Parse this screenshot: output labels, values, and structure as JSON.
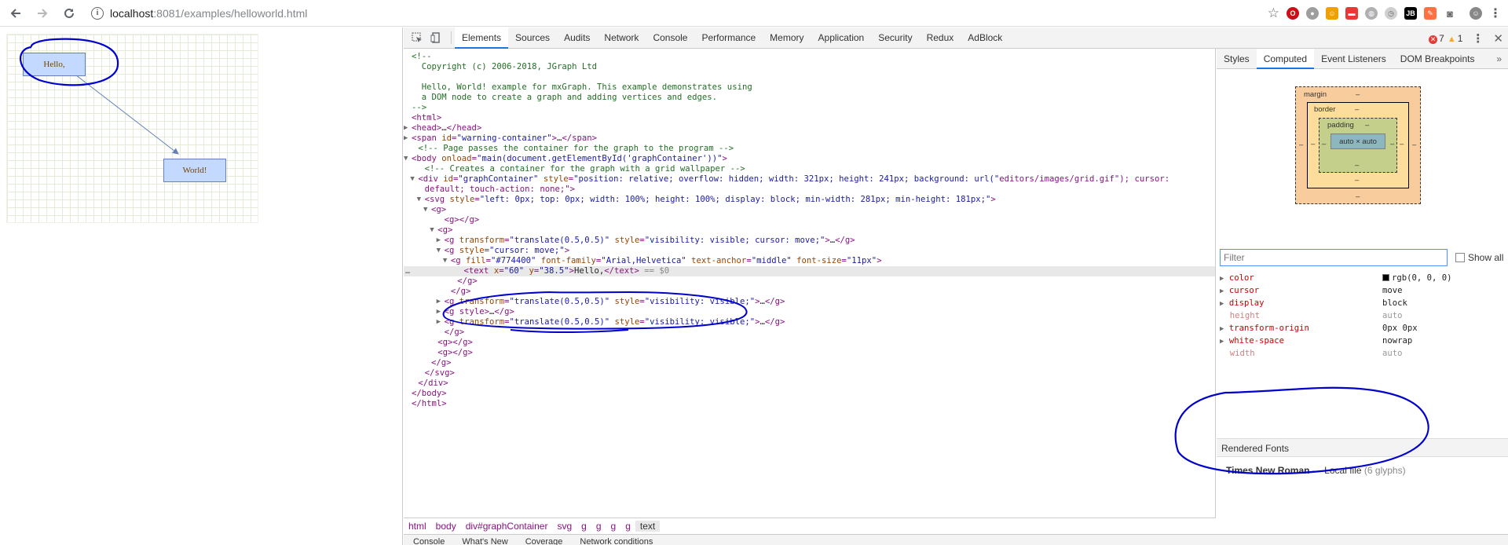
{
  "browser": {
    "url_host": "localhost",
    "url_path": ":8081/examples/helloworld.html"
  },
  "graph": {
    "vertex1_label": "Hello,",
    "vertex2_label": "World!"
  },
  "devtools": {
    "tabs": [
      "Elements",
      "Sources",
      "Audits",
      "Network",
      "Console",
      "Performance",
      "Memory",
      "Application",
      "Security",
      "Redux",
      "AdBlock"
    ],
    "errors": "7",
    "warnings": "1",
    "code_lines": [
      "<!--",
      "  Copyright (c) 2006-2018, JGraph Ltd",
      "",
      "  Hello, World! example for mxGraph. This example demonstrates using",
      "  a DOM node to create a graph and adding vertices and edges.",
      "-->",
      "<html>",
      "<head>…</head>",
      "<span id=\"warning-container\">…</span>",
      "<!-- Page passes the container for the graph to the program -->",
      "<body onload=\"main(document.getElementById('graphContainer'))\">",
      "<!-- Creates a container for the graph with a grid wallpaper -->",
      "<div id=\"graphContainer\" style=\"position: relative; overflow: hidden; width: 321px; height: 241px; background: url(\"editors/images/grid.gif\"); cursor:",
      "default; touch-action: none;\">",
      "<svg style=\"left: 0px; top: 0px; width: 100%; height: 100%; display: block; min-width: 281px; min-height: 181px;\">",
      "<g>",
      "<g></g>",
      "<g>",
      "<g transform=\"translate(0.5,0.5)\" style=\"visibility: visible; cursor: move;\">…</g>",
      "<g style=\"cursor: move;\">",
      "<g fill=\"#774400\" font-family=\"Arial,Helvetica\" text-anchor=\"middle\" font-size=\"11px\">",
      "<text x=\"60\" y=\"38.5\">Hello,</text> == $0",
      "</g>",
      "</g>",
      "<g transform=\"translate(0.5,0.5)\" style=\"visibility: visible;\">…</g>",
      "<g style>…</g>",
      "<g transform=\"translate(0.5,0.5)\" style=\"visibility: visible;\">…</g>",
      "</g>",
      "<g></g>",
      "<g></g>",
      "</g>",
      "</svg>",
      "</div>",
      "</body>",
      "</html>"
    ],
    "breadcrumbs": [
      "html",
      "body",
      "div#graphContainer",
      "svg",
      "g",
      "g",
      "g",
      "g",
      "text"
    ],
    "drawer_tabs": [
      "Console",
      "What's New",
      "Coverage",
      "Network conditions"
    ]
  },
  "sidebar": {
    "tabs": [
      "Styles",
      "Computed",
      "Event Listeners",
      "DOM Breakpoints"
    ],
    "box_model": {
      "margin_label": "margin",
      "border_label": "border",
      "padding_label": "padding",
      "dash": "–",
      "content": "auto × auto"
    },
    "filter_placeholder": "Filter",
    "show_all_label": "Show all",
    "properties": [
      {
        "name": "color",
        "value": "rgb(0, 0, 0)",
        "inherited": false
      },
      {
        "name": "cursor",
        "value": "move",
        "inherited": false
      },
      {
        "name": "display",
        "value": "block",
        "inherited": false
      },
      {
        "name": "height",
        "value": "auto",
        "inherited": true
      },
      {
        "name": "transform-origin",
        "value": "0px 0px",
        "inherited": false
      },
      {
        "name": "white-space",
        "value": "nowrap",
        "inherited": false
      },
      {
        "name": "width",
        "value": "auto",
        "inherited": true
      }
    ],
    "rendered_fonts_title": "Rendered Fonts",
    "font_name": "Times New Roman",
    "font_sep": "—",
    "font_source": "Local file",
    "font_glyphs": "(6 glyphs)"
  },
  "colors": {
    "accent": "#1a73e8",
    "annotation": "#0000cc",
    "vertex_fill": "#c3d9ff",
    "vertex_stroke": "#6482b9"
  }
}
